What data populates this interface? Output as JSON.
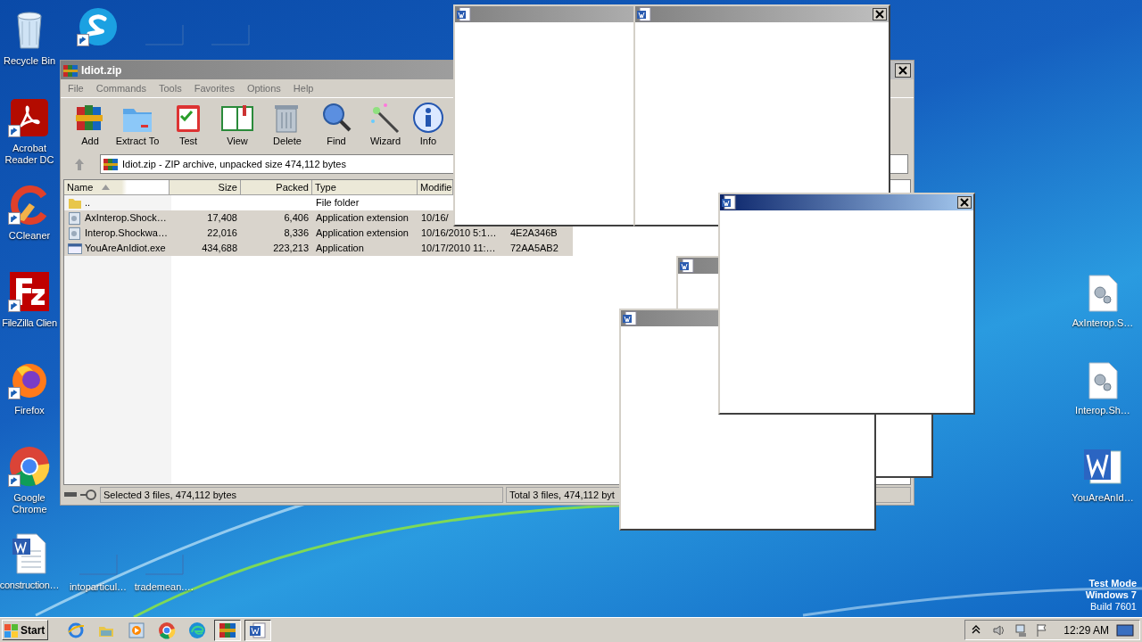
{
  "desktop_icons": {
    "left": [
      {
        "kind": "recycle-bin",
        "label": "Recycle Bin",
        "shortcut": false
      },
      {
        "kind": "pdf",
        "label": "Acrobat Reader DC",
        "shortcut": true
      },
      {
        "kind": "ccleaner",
        "label": "CCleaner",
        "shortcut": true
      },
      {
        "kind": "filezilla",
        "label": "FileZilla Clien",
        "shortcut": true
      },
      {
        "kind": "firefox",
        "label": "Firefox",
        "shortcut": true
      },
      {
        "kind": "chrome",
        "label": "Google Chrome",
        "shortcut": true
      },
      {
        "kind": "word-doc",
        "label": "construction…",
        "shortcut": false
      }
    ],
    "top": [
      {
        "kind": "skype",
        "shortcut": true
      },
      {
        "kind": "blank",
        "shortcut": false
      },
      {
        "kind": "blank",
        "shortcut": false
      }
    ],
    "bottom": [
      {
        "kind": "blank",
        "label": "intoparticul…",
        "shortcut": false
      },
      {
        "kind": "blank",
        "label": "trademean.…",
        "shortcut": false
      }
    ],
    "right": [
      {
        "kind": "gear-doc",
        "label": "AxInterop.S…",
        "shortcut": false
      },
      {
        "kind": "gear-doc",
        "label": "Interop.Sh…",
        "shortcut": false
      },
      {
        "kind": "word",
        "label": "YouAreAnId…",
        "shortcut": false
      }
    ]
  },
  "winrar": {
    "title": "Idiot.zip",
    "menu": [
      "File",
      "Commands",
      "Tools",
      "Favorites",
      "Options",
      "Help"
    ],
    "toolbar": [
      {
        "kind": "add",
        "label": "Add"
      },
      {
        "kind": "extract",
        "label": "Extract To"
      },
      {
        "kind": "test",
        "label": "Test"
      },
      {
        "kind": "view",
        "label": "View"
      },
      {
        "kind": "delete",
        "label": "Delete"
      },
      {
        "kind": "find",
        "label": "Find"
      },
      {
        "kind": "wizard",
        "label": "Wizard"
      },
      {
        "kind": "info",
        "label": "Info"
      }
    ],
    "address": "Idiot.zip - ZIP archive, unpacked size 474,112 bytes",
    "columns": [
      {
        "label": "Name",
        "sorted": true
      },
      {
        "label": "Size",
        "sorted": false
      },
      {
        "label": "Packed",
        "sorted": false
      },
      {
        "label": "Type",
        "sorted": false
      },
      {
        "label": "Modifie",
        "sorted": false
      }
    ],
    "rows": [
      {
        "kind": "folder",
        "selected": false,
        "name": "..",
        "type": "File folder"
      },
      {
        "kind": "dll",
        "selected": true,
        "name": "AxInterop.Shock…",
        "size": "17,408",
        "packed": "6,406",
        "type": "Application extension",
        "modified": "10/16/"
      },
      {
        "kind": "dll",
        "selected": true,
        "name": "Interop.Shockwa…",
        "size": "22,016",
        "packed": "8,336",
        "type": "Application extension",
        "modified": "10/16/2010 5:1…",
        "column_6": "4E2A346B"
      },
      {
        "kind": "exe",
        "selected": true,
        "name": "YouAreAnIdiot.exe",
        "size": "434,688",
        "packed": "223,213",
        "type": "Application",
        "modified": "10/17/2010 11:…",
        "column_6": "72AA5AB2"
      }
    ],
    "status_left": "Selected 3 files, 474,112 bytes",
    "status_right": "Total 3 files, 474,112 byt"
  },
  "popups": [
    {
      "active": false,
      "close_button": false
    },
    {
      "active": false,
      "close_button": true
    },
    {
      "active": false,
      "close_button": false
    },
    {
      "active": false,
      "close_button": false
    },
    {
      "active": true,
      "close_button": true
    }
  ],
  "watermark": [
    "Test Mode",
    "Windows 7",
    "Build 7601"
  ],
  "taskbar": {
    "start": "Start",
    "items": [
      {
        "kind": "ie",
        "open": false
      },
      {
        "kind": "explorer",
        "open": false
      },
      {
        "kind": "media",
        "open": false
      },
      {
        "kind": "chrome",
        "open": false
      },
      {
        "kind": "edge",
        "open": false
      },
      {
        "kind": "winrar",
        "open": true
      },
      {
        "kind": "word",
        "open": true
      }
    ],
    "clock": "12:29 AM"
  }
}
